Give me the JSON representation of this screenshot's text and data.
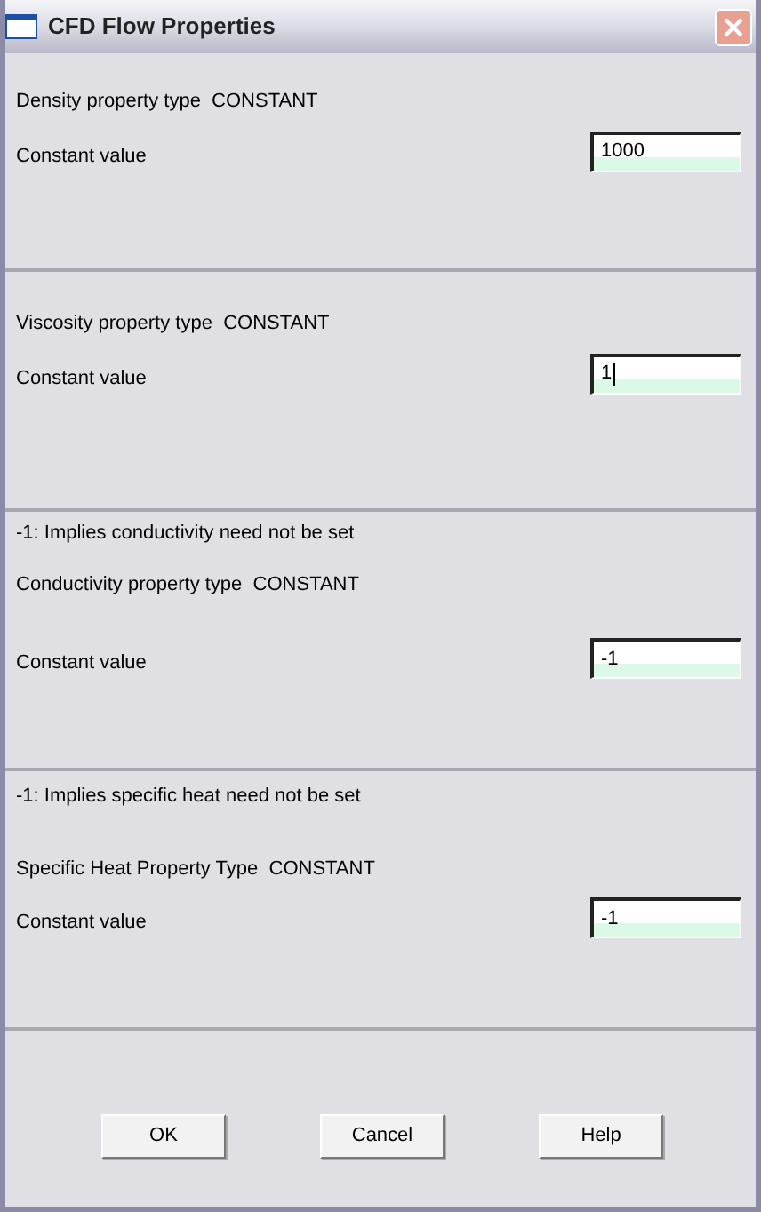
{
  "window": {
    "title": "CFD Flow Properties"
  },
  "sections": [
    {
      "lines": [
        "Density property type  CONSTANT"
      ],
      "field": {
        "label": "Constant value",
        "value": "1000",
        "focused": false
      }
    },
    {
      "lines": [
        "Viscosity property type  CONSTANT"
      ],
      "field": {
        "label": "Constant value",
        "value": "1",
        "focused": true
      }
    },
    {
      "lines": [
        "-1: Implies conductivity need not be set",
        "Conductivity property type  CONSTANT"
      ],
      "field": {
        "label": "Constant value",
        "value": "-1",
        "focused": false
      }
    },
    {
      "lines": [
        "-1: Implies specific heat need not be set",
        "Specific Heat Property Type  CONSTANT"
      ],
      "field": {
        "label": "Constant value",
        "value": "-1",
        "focused": false
      }
    }
  ],
  "buttons": [
    "OK",
    "Cancel",
    "Help"
  ]
}
